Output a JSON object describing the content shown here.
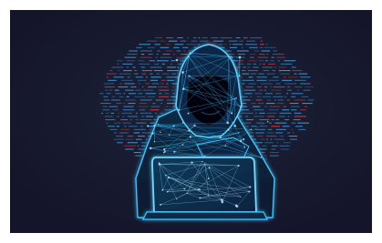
{
  "scene": {
    "subject": "hooded-figure-with-laptop",
    "style": "low-poly wireframe illustration",
    "colors": {
      "background": "#16172a",
      "frame": "#ffffff",
      "glow": "#3cc4ff",
      "glow_light": "#a9e7ff",
      "data_blue": "#3fa0e6",
      "data_red": "#e0383e"
    },
    "icons": [
      "hood-icon",
      "laptop-icon",
      "data-stream-icon"
    ]
  }
}
